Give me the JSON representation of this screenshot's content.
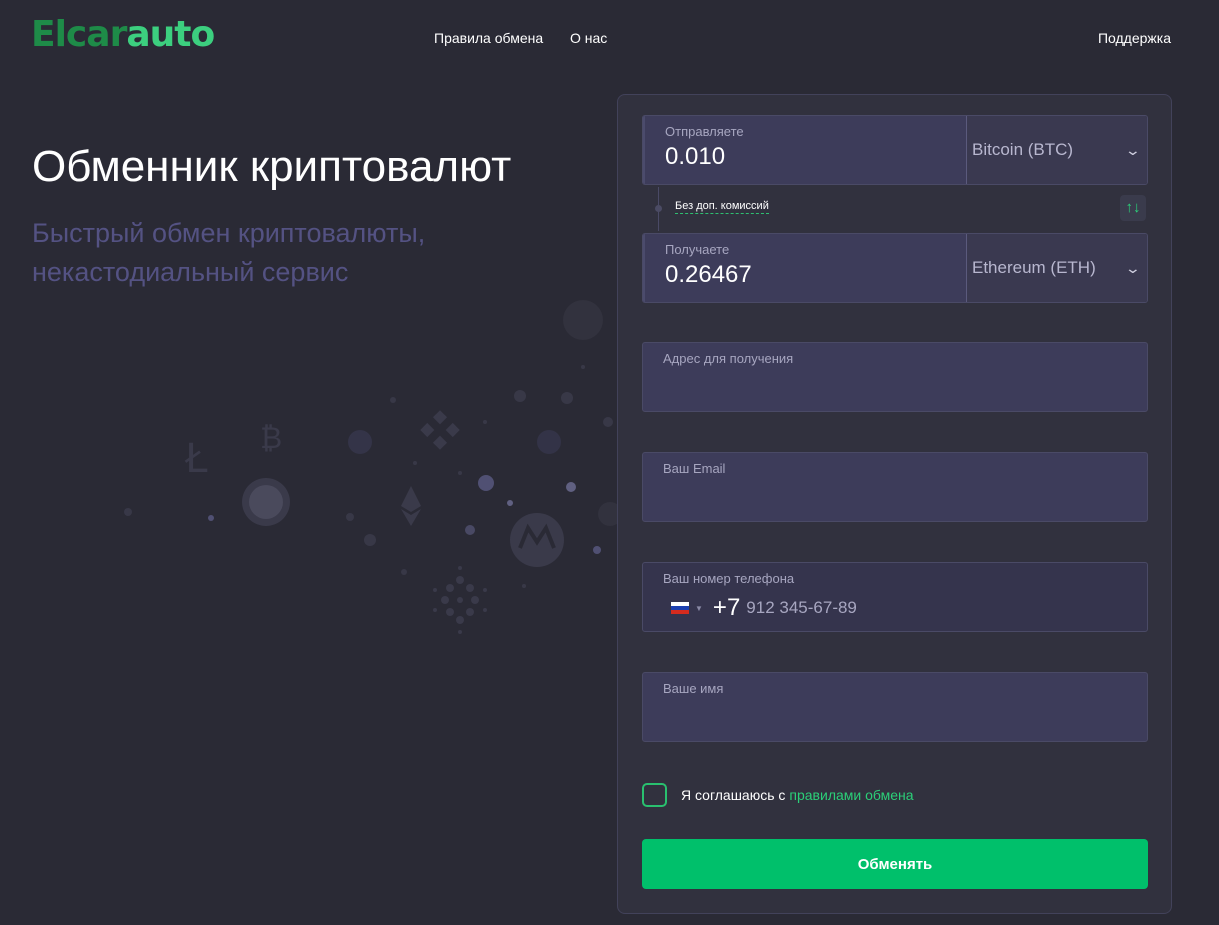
{
  "header": {
    "logo_part1": "Elcar",
    "logo_part2": "auto",
    "nav": {
      "rules": "Правила обмена",
      "about": "О нас",
      "support": "Поддержка"
    }
  },
  "hero": {
    "title": "Обменник криптовалют",
    "subtitle": "Быстрый обмен криптовалюты, некастодиальный сервис"
  },
  "form": {
    "send": {
      "label": "Отправляете",
      "value": "0.010",
      "currency": "Bitcoin (BTC)"
    },
    "fee_note": "Без доп. комиссий",
    "swap_icon": "swap-arrows-icon",
    "receive": {
      "label": "Получаете",
      "value": "0.26467",
      "currency": "Ethereum (ETH)"
    },
    "address_label": "Адрес для получения",
    "email_label": "Ваш Email",
    "phone": {
      "label": "Ваш номер телефона",
      "code": "+7",
      "placeholder": "912 345-67-89"
    },
    "name_label": "Ваше имя",
    "agree_text": "Я соглашаюсь с",
    "agree_link": "правилами обмена",
    "submit": "Обменять"
  },
  "colors": {
    "background": "#2a2a35",
    "accent": "#00c06b",
    "field": "#3d3c5a",
    "subtitle": "#545283"
  }
}
